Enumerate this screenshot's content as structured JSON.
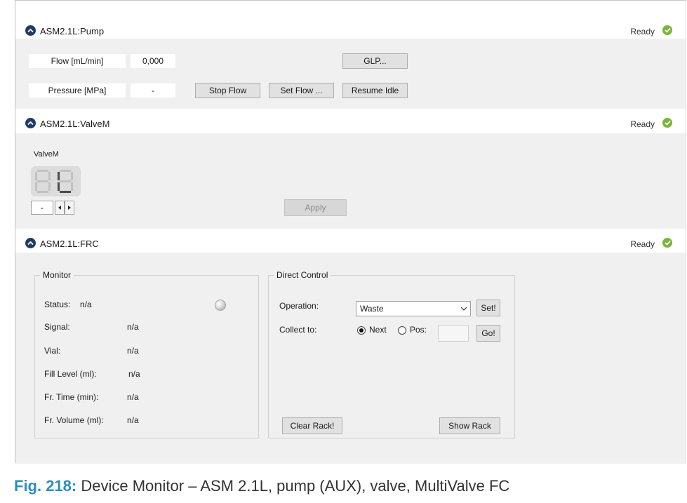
{
  "colors": {
    "accent": "#1f3c68",
    "ready": "#7ab43b",
    "caption_number": "#2d8fc1"
  },
  "pump": {
    "title": "ASM2.1L:Pump",
    "status": "Ready",
    "flow_label": "Flow [mL/min]",
    "flow_value": "0,000",
    "pressure_label": "Pressure [MPa]",
    "pressure_value": "-",
    "glp_button": "GLP...",
    "stop_flow_button": "Stop Flow",
    "set_flow_button": "Set Flow ...",
    "resume_idle_button": "Resume Idle"
  },
  "valve": {
    "title": "ASM2.1L:ValveM",
    "status": "Ready",
    "label": "ValveM",
    "position_value": "-",
    "apply_button": "Apply"
  },
  "frc": {
    "title": "ASM2.1L:FRC",
    "status": "Ready",
    "monitor": {
      "title": "Monitor",
      "status_label": "Status:",
      "status_value": "n/a",
      "signal_label": "Signal:",
      "signal_value": "n/a",
      "vial_label": "Vial:",
      "vial_value": "n/a",
      "fill_level_label": "Fill Level (ml):",
      "fill_level_value": "n/a",
      "fr_time_label": "Fr. Time (min):",
      "fr_time_value": "n/a",
      "fr_volume_label": "Fr. Volume (ml):",
      "fr_volume_value": "n/a"
    },
    "direct_control": {
      "title": "Direct Control",
      "operation_label": "Operation:",
      "operation_value": "Waste",
      "set_button": "Set!",
      "collect_to_label": "Collect to:",
      "next_label": "Next",
      "pos_label": "Pos:",
      "go_button": "Go!",
      "clear_rack_button": "Clear Rack!",
      "show_rack_button": "Show Rack"
    }
  },
  "caption": {
    "number": "Fig. 218:",
    "text": "Device Monitor – ASM 2.1L, pump (AUX), valve, MultiValve FC"
  }
}
